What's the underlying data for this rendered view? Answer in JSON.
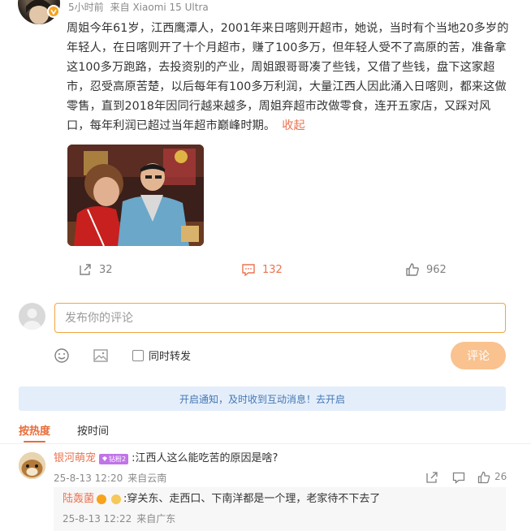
{
  "post": {
    "meta": {
      "time": "5小时前",
      "source": "来自 Xiaomi 15 Ultra"
    },
    "text": "周姐今年61岁，江西鹰潭人，2001年来日喀则开超市，她说，当时有个当地20多岁的年轻人，在日喀则开了十个月超市，赚了100多万，但年轻人受不了高原的苦，准备拿这100多万跑路，去投资别的产业，周姐跟哥哥凑了些钱，又借了些钱，盘下这家超市，忍受高原苦楚，以后每年有100多万利润，大量江西人因此涌入日喀则，都来这做零售，直到2018年因同行越来越多，周姐弃超市改做零食，连开五家店，又踩对风口，每年利润已超过当年超市巅峰时期。",
    "collapse_label": "收起",
    "actions": {
      "repost_count": "32",
      "comment_count": "132",
      "like_count": "962"
    }
  },
  "composer": {
    "placeholder": "发布你的评论",
    "repost_label": "同时转发",
    "submit_label": "评论"
  },
  "notice": {
    "text": "开启通知，及时收到互动消息！去开启"
  },
  "sort": {
    "hot_label": "按热度",
    "time_label": "按时间"
  },
  "comment": {
    "username": "银河萌宠",
    "badge": "钻粉2",
    "text": ":江西人这么能吃苦的原因是啥?",
    "date": "25-8-13 12:20",
    "location": "来自云南",
    "like_count": "26"
  },
  "reply": {
    "username": "陆轰菌",
    "text": ":穿关东、走西口、下南洋都是一个理，老家待不下去了",
    "date": "25-8-13 12:22",
    "location": "来自广东"
  },
  "colors": {
    "accent": "#eb7350",
    "input_border": "#f2a540",
    "button_disabled": "#f9c28f",
    "notice_bg": "#e4eefa",
    "notice_text": "#4577b4",
    "badge": "#c174e8"
  },
  "icons": [
    "verified-icon",
    "share-icon",
    "comment-icon",
    "like-icon",
    "emoji-icon",
    "image-icon",
    "share-icon",
    "comment-icon",
    "like-icon",
    "vip-icon",
    "crown-icon"
  ]
}
